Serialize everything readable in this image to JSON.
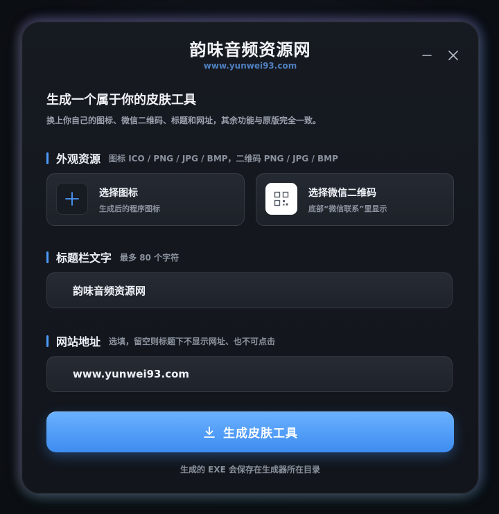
{
  "window": {
    "title": "韵味音频资源网",
    "subtitle": "www.yunwei93.com"
  },
  "intro": {
    "heading": "生成一个属于你的皮肤工具",
    "description": "换上你自己的图标、微信二维码、标题和网址，其余功能与原版完全一致。"
  },
  "appearance": {
    "label": "外观资源",
    "hint": "图标 ICO / PNG / JPG / BMP，二维码 PNG / JPG / BMP",
    "icon_card": {
      "title": "选择图标",
      "subtitle": "生成后的程序图标",
      "icon": "plus-icon"
    },
    "qr_card": {
      "title": "选择微信二维码",
      "subtitle": "底部“微信联系”里显示",
      "icon": "qr-code-icon"
    }
  },
  "title_text": {
    "label": "标题栏文字",
    "hint": "最多 80 个字符",
    "value": "韵味音频资源网"
  },
  "website": {
    "label": "网站地址",
    "hint": "选填，留空则标题下不显示网址、也不可点击",
    "value": "www.yunwei93.com"
  },
  "generate_button": {
    "label": "生成皮肤工具",
    "icon": "download-icon"
  },
  "footer": {
    "note": "生成的 EXE 会保存在生成器所在目录"
  },
  "colors": {
    "accent": "#4d9bff",
    "button_top": "#6ab1ff",
    "button_bottom": "#3d8cf0",
    "subtitle_link": "#4f7fc0"
  }
}
